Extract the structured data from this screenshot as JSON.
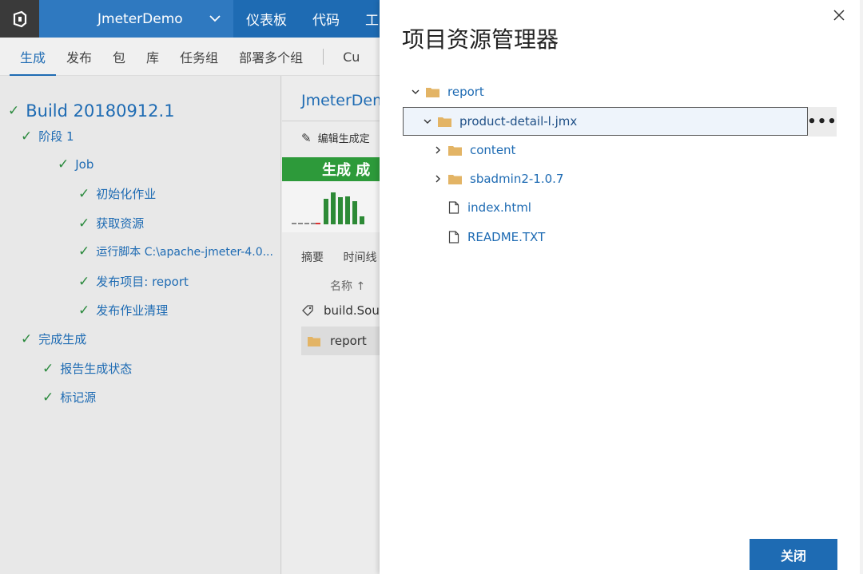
{
  "header": {
    "project_name": "JmeterDemo",
    "nav": [
      "仪表板",
      "代码",
      "工"
    ]
  },
  "subnav": {
    "tabs": [
      "生成",
      "发布",
      "包",
      "库",
      "任务组",
      "部署多个组"
    ],
    "overflow": "Cu"
  },
  "build_tree": {
    "title": "Build 20180912.1",
    "items": [
      {
        "label": "阶段 1"
      },
      {
        "label": "Job"
      },
      {
        "label": "初始化作业"
      },
      {
        "label": "获取资源"
      },
      {
        "label": "运行脚本 C:\\apache-jmeter-4.0..."
      },
      {
        "label": "发布项目: report"
      },
      {
        "label": "发布作业清理"
      },
      {
        "label": "完成生成"
      },
      {
        "label": "报告生成状态"
      },
      {
        "label": "标记源"
      }
    ]
  },
  "middle": {
    "title": "JmeterDem",
    "edit_label": "编辑生成定",
    "status_banner": "生成 成",
    "tabs": [
      "摘要",
      "时间线"
    ],
    "column_header": "名称 ↑",
    "rows": [
      {
        "label": "build.Sou",
        "icon": "tag-icon"
      },
      {
        "label": "report",
        "icon": "folder-icon"
      }
    ],
    "history_bars": [
      0.72,
      0.92,
      0.78,
      0.8,
      0.65,
      0.22
    ]
  },
  "dialog": {
    "title": "项目资源管理器",
    "tree": [
      {
        "label": "report",
        "type": "folder",
        "expanded": true
      },
      {
        "label": "product-detail-l.jmx",
        "type": "folder",
        "expanded": true,
        "selected": true
      },
      {
        "label": "content",
        "type": "folder",
        "expanded": false
      },
      {
        "label": "sbadmin2-1.0.7",
        "type": "folder",
        "expanded": false
      },
      {
        "label": "index.html",
        "type": "file"
      },
      {
        "label": "README.TXT",
        "type": "file"
      }
    ],
    "more_label": "•••",
    "close_button": "关闭"
  },
  "colors": {
    "brand_blue": "#1e6bb3",
    "success_green": "#2d9a3a",
    "folder_tan": "#e3b465"
  }
}
